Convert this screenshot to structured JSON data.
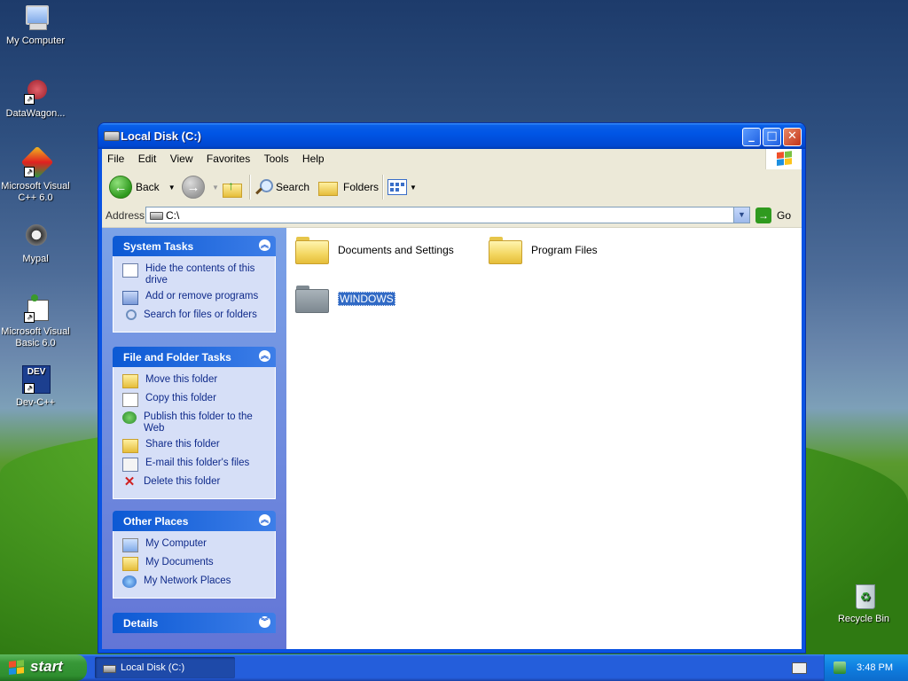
{
  "desktop": {
    "icons": [
      {
        "label": "My Computer"
      },
      {
        "label": "DataWagon..."
      },
      {
        "label": "Microsoft Visual C++ 6.0"
      },
      {
        "label": "Mypal"
      },
      {
        "label": "Microsoft Visual Basic 6.0"
      },
      {
        "label": "Dev-C++"
      },
      {
        "label": "Recycle Bin"
      }
    ]
  },
  "window": {
    "title": "Local Disk (C:)",
    "controls": {
      "minimize": "_",
      "maximize": "□",
      "close": "✕"
    },
    "menu": [
      "File",
      "Edit",
      "View",
      "Favorites",
      "Tools",
      "Help"
    ],
    "toolbar": {
      "back": "Back",
      "search": "Search",
      "folders": "Folders"
    },
    "address": {
      "label": "Address",
      "value": "C:\\",
      "go": "Go"
    }
  },
  "sidebar": {
    "system_tasks": {
      "title": "System Tasks",
      "items": [
        "Hide the contents of this drive",
        "Add or remove programs",
        "Search for files or folders"
      ]
    },
    "file_folder_tasks": {
      "title": "File and Folder Tasks",
      "items": [
        "Move this folder",
        "Copy this folder",
        "Publish this folder to the Web",
        "Share this folder",
        "E-mail this folder's files",
        "Delete this folder"
      ]
    },
    "other_places": {
      "title": "Other Places",
      "items": [
        "My Computer",
        "My Documents",
        "My Network Places"
      ]
    },
    "details": {
      "title": "Details"
    }
  },
  "files": [
    {
      "name": "Documents and Settings"
    },
    {
      "name": "Program Files"
    },
    {
      "name": "WINDOWS"
    }
  ],
  "taskbar": {
    "start": "start",
    "task": "Local Disk (C:)",
    "clock": "3:48 PM"
  }
}
